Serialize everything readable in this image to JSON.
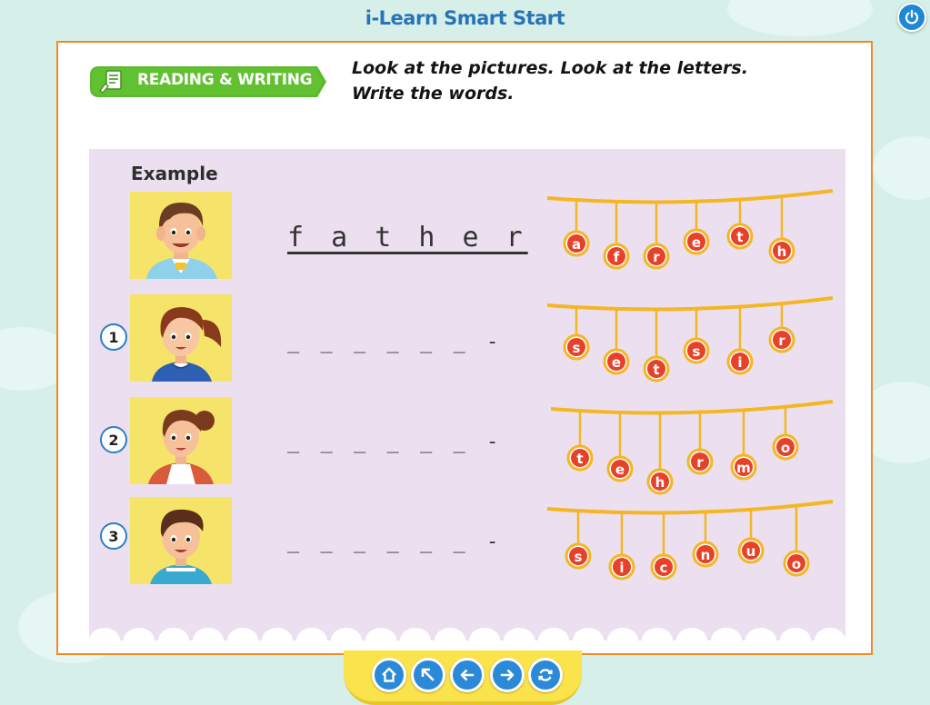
{
  "app_title": "i-Learn Smart Start",
  "section_badge": "READING & WRITING",
  "instructions": {
    "line1": "Look at the pictures. Look at the letters.",
    "line2": "Write the words."
  },
  "example_label": "Example",
  "items": [
    {
      "number": "",
      "answer": "f a t h e r",
      "blanks": "",
      "letters": [
        "a",
        "f",
        "r",
        "e",
        "t",
        "h"
      ]
    },
    {
      "number": "1",
      "answer": "",
      "blanks": "_ _ _ _ _ _ -",
      "letters": [
        "s",
        "e",
        "t",
        "s",
        "i",
        "r"
      ]
    },
    {
      "number": "2",
      "answer": "",
      "blanks": "_ _ _ _ _ _ -",
      "letters": [
        "t",
        "e",
        "h",
        "r",
        "m",
        "o"
      ]
    },
    {
      "number": "3",
      "answer": "",
      "blanks": "_ _ _ _ _ _ -",
      "letters": [
        "s",
        "i",
        "c",
        "n",
        "u",
        "o"
      ]
    }
  ],
  "nav_buttons": [
    "home-icon",
    "arrow-up-left-icon",
    "arrow-left-icon",
    "arrow-right-icon",
    "refresh-icon"
  ],
  "colors": {
    "accent_blue": "#2a8ad8",
    "frame_orange": "#f08a24",
    "badge_green": "#5cb82e",
    "string_gold": "#f4b623",
    "letter_red": "#e8412a"
  }
}
